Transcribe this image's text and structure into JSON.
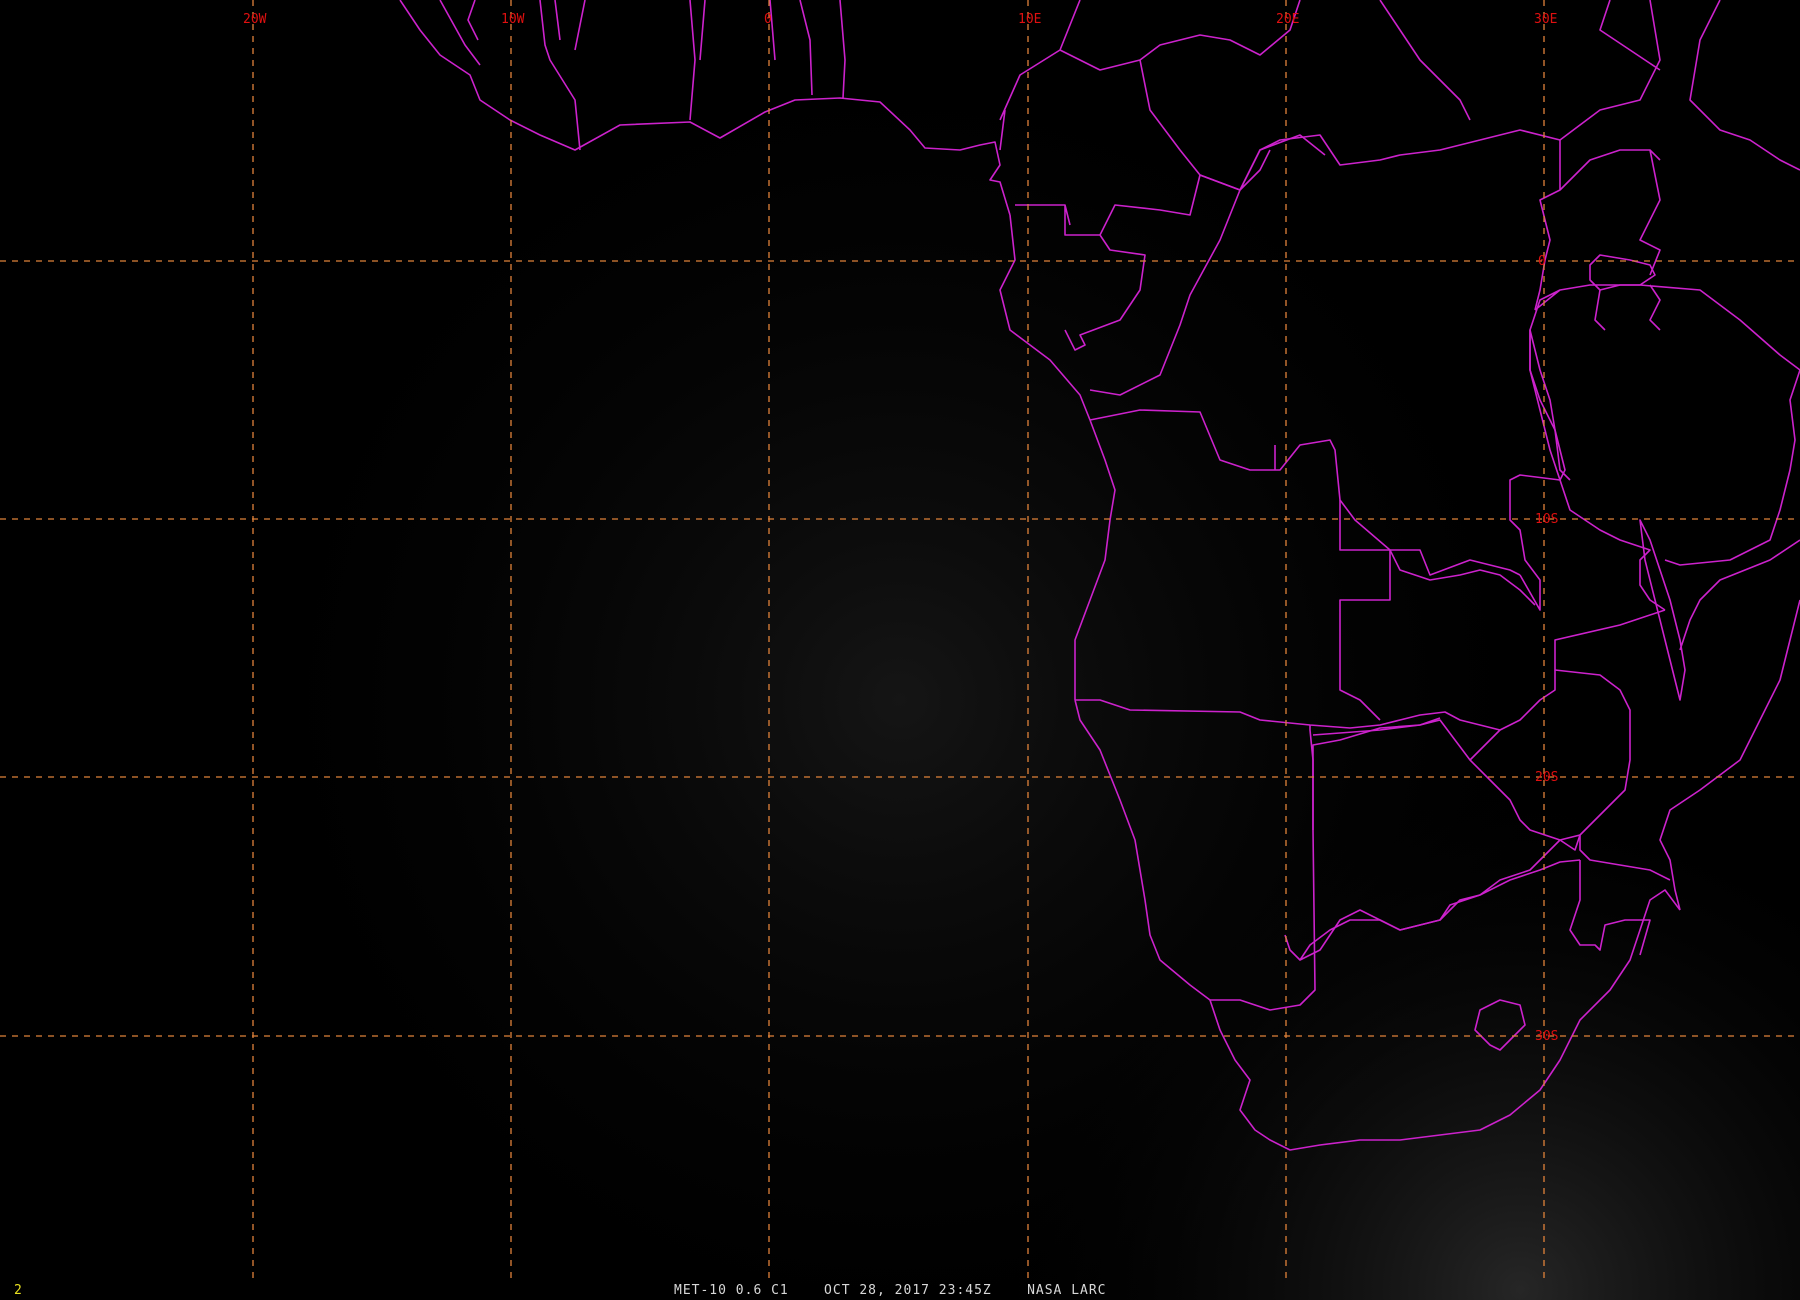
{
  "colors": {
    "background": "#000000",
    "graticule": "#e0823a",
    "graticule_label": "#e01010",
    "boundaries": "#cc22cc",
    "frame_number": "#e8e020",
    "caption": "#d8d8d8"
  },
  "graticule": {
    "longitude_labels": [
      "20W",
      "10W",
      "0",
      "10E",
      "20E",
      "30E"
    ],
    "latitude_labels": [
      "0",
      "10S",
      "20S",
      "30S"
    ],
    "style": "dashed"
  },
  "footer": {
    "frame_number": "2",
    "caption": "MET-10 0.6 C1    OCT 28, 2017 23:45Z    NASA LARC"
  },
  "icons": [
    "political-boundary-overlay"
  ]
}
